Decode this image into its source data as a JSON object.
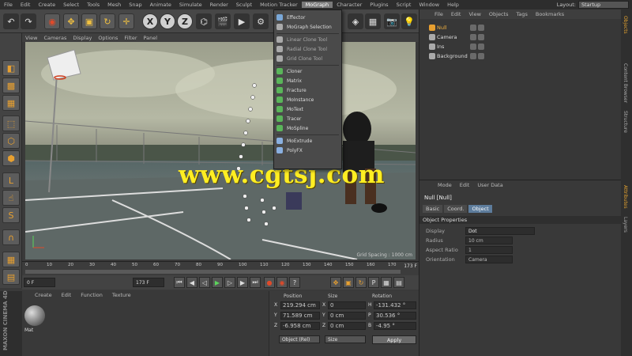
{
  "menubar": {
    "items": [
      "File",
      "Edit",
      "Create",
      "Select",
      "Tools",
      "Mesh",
      "Snap",
      "Animate",
      "Simulate",
      "Render",
      "Sculpt",
      "Motion Tracker",
      "MoGraph",
      "Character",
      "Plugins",
      "Script",
      "Window",
      "Help"
    ],
    "active_index": 12,
    "layout_label": "Layout:",
    "layout_value": "Startup"
  },
  "viewport": {
    "menu": [
      "View",
      "Cameras",
      "Display",
      "Options",
      "Filter",
      "Panel"
    ],
    "watermark": "Grid Spacing : 1000 cm"
  },
  "mograph_menu": {
    "items": [
      {
        "label": "Effector",
        "icon": "effector-icon",
        "color": "#7aa8d8",
        "dim": false
      },
      {
        "label": "MoGraph Selection",
        "icon": "selection-icon",
        "color": "#aaa",
        "dim": false
      },
      {
        "label": "Linear Clone Tool",
        "icon": "linear-clone-icon",
        "color": "#aaa",
        "dim": true
      },
      {
        "label": "Radial Clone Tool",
        "icon": "radial-clone-icon",
        "color": "#aaa",
        "dim": true
      },
      {
        "label": "Grid Clone Tool",
        "icon": "grid-clone-icon",
        "color": "#aaa",
        "dim": true
      },
      {
        "label": "Cloner",
        "icon": "cloner-icon",
        "color": "#5ab55a",
        "dim": false
      },
      {
        "label": "Matrix",
        "icon": "matrix-icon",
        "color": "#5ab55a",
        "dim": false
      },
      {
        "label": "Fracture",
        "icon": "fracture-icon",
        "color": "#5ab55a",
        "dim": false
      },
      {
        "label": "MoInstance",
        "icon": "moinstance-icon",
        "color": "#5ab55a",
        "dim": false
      },
      {
        "label": "MoText",
        "icon": "motext-icon",
        "color": "#5ab55a",
        "dim": false
      },
      {
        "label": "Tracer",
        "icon": "tracer-icon",
        "color": "#5ab55a",
        "dim": false
      },
      {
        "label": "MoSpline",
        "icon": "mospline-icon",
        "color": "#5ab55a",
        "dim": false
      },
      {
        "label": "MoExtrude",
        "icon": "moextrude-icon",
        "color": "#8ab0e0",
        "dim": false
      },
      {
        "label": "PolyFX",
        "icon": "polyfx-icon",
        "color": "#8ab0e0",
        "dim": false
      }
    ]
  },
  "timeline": {
    "ticks": [
      "0",
      "10",
      "20",
      "30",
      "40",
      "50",
      "60",
      "70",
      "80",
      "90",
      "100",
      "110",
      "120",
      "130",
      "140",
      "150",
      "160",
      "170"
    ],
    "end_label": "173 F"
  },
  "transport": {
    "start_field": "0 F",
    "end_field": "173 F"
  },
  "material": {
    "menu": [
      "Create",
      "Edit",
      "Function",
      "Texture"
    ],
    "name": "Mat"
  },
  "branding": "MAXON CINEMA 4D",
  "coordinates": {
    "headers": [
      "Position",
      "Size",
      "Rotation"
    ],
    "rows": [
      {
        "axis": "X",
        "pos": "219.294 cm",
        "size_axis": "X",
        "size": "0",
        "rot_axis": "H",
        "rot": "-131.432 °"
      },
      {
        "axis": "Y",
        "pos": "71.589 cm",
        "size_axis": "Y",
        "size": "0 cm",
        "rot_axis": "P",
        "rot": "30.536 °"
      },
      {
        "axis": "Z",
        "pos": "-6.958 cm",
        "size_axis": "Z",
        "size": "0 cm",
        "rot_axis": "B",
        "rot": "-4.95 °"
      }
    ],
    "mode": "Object (Rel)",
    "size_mode": "Size",
    "apply": "Apply"
  },
  "object_manager": {
    "menu": [
      "File",
      "Edit",
      "View",
      "Objects",
      "Tags",
      "Bookmarks"
    ],
    "objects": [
      {
        "name": "Null",
        "icon_color": "#e8a030",
        "selected": true
      },
      {
        "name": "Camera",
        "icon_color": "#aaa",
        "selected": false
      },
      {
        "name": "Ins",
        "icon_color": "#aaa",
        "selected": false
      },
      {
        "name": "Background",
        "icon_color": "#aaa",
        "selected": false
      }
    ]
  },
  "attributes": {
    "menu": [
      "Mode",
      "Edit",
      "User Data"
    ],
    "title": "Null [Null]",
    "tabs": [
      "Basic",
      "Coord.",
      "Object"
    ],
    "active_tab": 2,
    "section": "Object Properties",
    "props": [
      {
        "label": "Display",
        "value": "Dot"
      },
      {
        "label": "Radius",
        "value": "10 cm"
      },
      {
        "label": "Aspect Ratio",
        "value": "1"
      },
      {
        "label": "Orientation",
        "value": "Camera"
      }
    ]
  },
  "right_strip": {
    "top_tabs": [
      "Objects",
      "Content Browser",
      "Structure"
    ],
    "bottom_tabs": [
      "Attributes",
      "Layers"
    ]
  },
  "overlay": {
    "text": "www.cgtsj.com",
    "color": "#ffee22"
  }
}
